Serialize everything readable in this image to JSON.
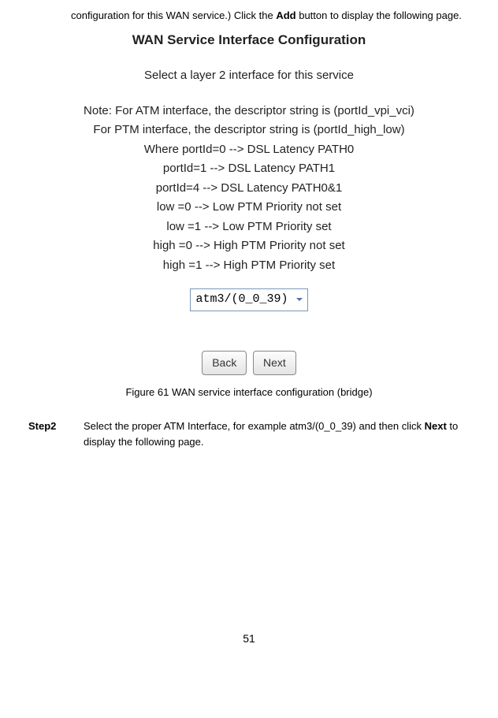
{
  "intro": {
    "prefix": "configuration for this WAN service.) Click the ",
    "bold": "Add",
    "suffix": " button to display the following page."
  },
  "title": "WAN Service Interface Configuration",
  "subtitle": "Select a layer 2 interface for this service",
  "note_lines": [
    "Note: For ATM interface, the descriptor string is (portId_vpi_vci)",
    "For PTM interface, the descriptor string is (portId_high_low)",
    "Where portId=0 --> DSL Latency PATH0",
    "portId=1 --> DSL Latency PATH1",
    "portId=4 --> DSL Latency PATH0&1",
    "low =0 --> Low PTM Priority not set",
    "low =1 --> Low PTM Priority set",
    "high =0 --> High PTM Priority not set",
    "high =1 --> High PTM Priority set"
  ],
  "select": {
    "value": "atm3/(0_0_39)"
  },
  "buttons": {
    "back": "Back",
    "next": "Next"
  },
  "figure_caption": "Figure 61 WAN service interface configuration (bridge)",
  "step2": {
    "label": "Step2",
    "prefix": "Select the proper ATM Interface, for example atm3/(0_0_39) and then click ",
    "bold": "Next",
    "suffix": " to display the following page."
  },
  "page_number": "51"
}
